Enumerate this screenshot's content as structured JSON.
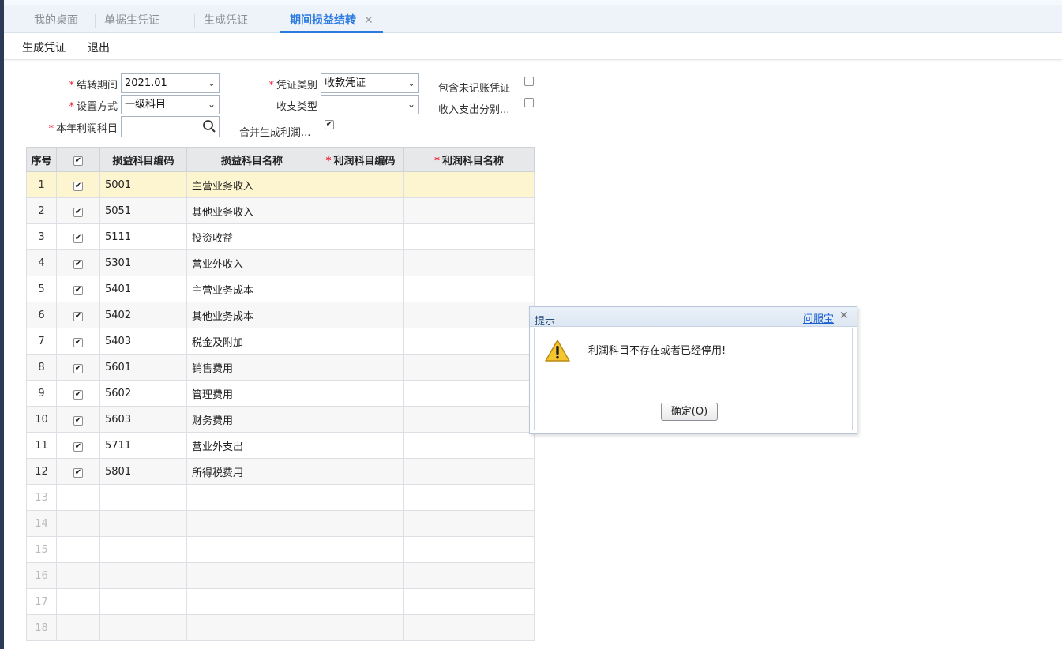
{
  "tabs": [
    {
      "label": "我的桌面"
    },
    {
      "label": "单据生凭证"
    },
    {
      "label": "生成凭证"
    },
    {
      "label": "期间损益结转",
      "close": "✕"
    }
  ],
  "toolbar": {
    "generate": "生成凭证",
    "exit": "退出"
  },
  "form": {
    "required_mark": "*",
    "period_label": "结转期间",
    "period_value": "2021.01",
    "voucher_type_label": "凭证类别",
    "voucher_type_value": "收款凭证",
    "include_unposted_label": "包含未记账凭证",
    "setting_method_label": "设置方式",
    "setting_method_value": "一级科目",
    "income_expense_type_label": "收支类型",
    "income_expense_type_value": "",
    "income_expense_split_label": "收入支出分别...",
    "profit_account_label": "本年利润科目",
    "profit_account_value": "",
    "merge_profit_label": "合并生成利润...",
    "merge_profit_checked": true
  },
  "grid": {
    "headers": [
      "序号",
      "损益科目编码",
      "损益科目名称",
      "利润科目编码",
      "利润科目名称"
    ],
    "rows": [
      {
        "no": "1",
        "code": "5001",
        "name": "主营业务收入",
        "checked": true
      },
      {
        "no": "2",
        "code": "5051",
        "name": "其他业务收入",
        "checked": true
      },
      {
        "no": "3",
        "code": "5111",
        "name": "投资收益",
        "checked": true
      },
      {
        "no": "4",
        "code": "5301",
        "name": "营业外收入",
        "checked": true
      },
      {
        "no": "5",
        "code": "5401",
        "name": "主营业务成本",
        "checked": true
      },
      {
        "no": "6",
        "code": "5402",
        "name": "其他业务成本",
        "checked": true
      },
      {
        "no": "7",
        "code": "5403",
        "name": "税金及附加",
        "checked": true
      },
      {
        "no": "8",
        "code": "5601",
        "name": "销售费用",
        "checked": true
      },
      {
        "no": "9",
        "code": "5602",
        "name": "管理费用",
        "checked": true
      },
      {
        "no": "10",
        "code": "5603",
        "name": "财务费用",
        "checked": true
      },
      {
        "no": "11",
        "code": "5711",
        "name": "营业外支出",
        "checked": true
      },
      {
        "no": "12",
        "code": "5801",
        "name": "所得税费用",
        "checked": true
      },
      {
        "no": "13"
      },
      {
        "no": "14"
      },
      {
        "no": "15"
      },
      {
        "no": "16"
      },
      {
        "no": "17"
      },
      {
        "no": "18"
      }
    ]
  },
  "dialog": {
    "title": "提示",
    "help": "问服宝",
    "close": "✕",
    "message": "利润科目不存在或者已经停用!",
    "ok": "确定(O)"
  }
}
